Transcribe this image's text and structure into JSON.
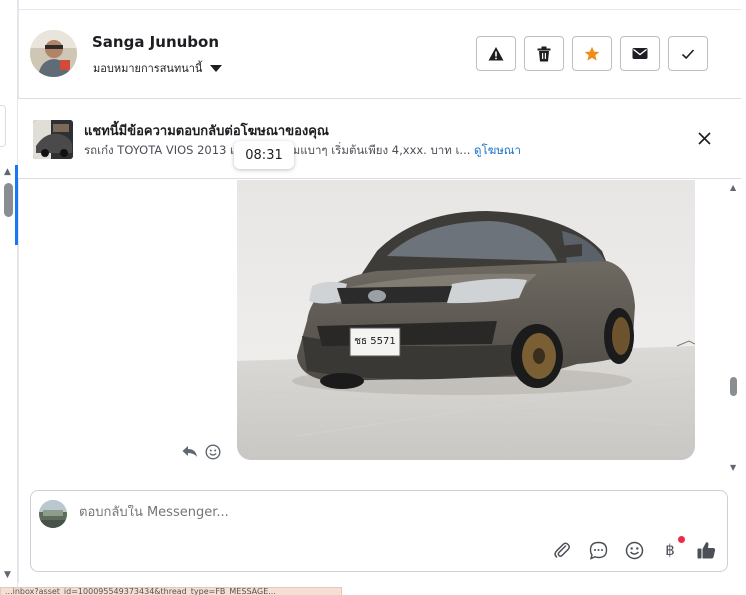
{
  "header": {
    "user_name": "Sanga Junubon",
    "assign_label": "มอบหมายการสนทนานี้"
  },
  "actions": {
    "icons": [
      "warning-icon",
      "trash-icon",
      "star-icon",
      "mail-icon",
      "check-icon"
    ],
    "star_color": "#f28c18"
  },
  "ad_banner": {
    "title": "แชทนี้มีข้อความตอบกลับต่อโฆษณาของคุณ",
    "description": "รถเก๋ง TOYOTA VIOS 2013 เค",
    "description_tail": "มแบาๆ เริ่มต้นเพียง 4,xxx. บาท เ...",
    "link": "ดูโฆษณา"
  },
  "message": {
    "timestamp": "08:31",
    "license_plate": "ชธ 5571"
  },
  "composer": {
    "placeholder": "ตอบกลับใน Messenger...",
    "tools": [
      "attachment-icon",
      "chat-bubble-icon",
      "emoji-icon",
      "baht-icon",
      "thumbs-up-icon"
    ],
    "baht_symbol": "฿"
  },
  "status_bar": {
    "text": "...inbox?asset_id=100095549373434&thread_type=FB_MESSAGE..."
  },
  "colors": {
    "link": "#1a73c9",
    "accent_blue": "#1877f2",
    "notification_dot": "#f02849"
  }
}
